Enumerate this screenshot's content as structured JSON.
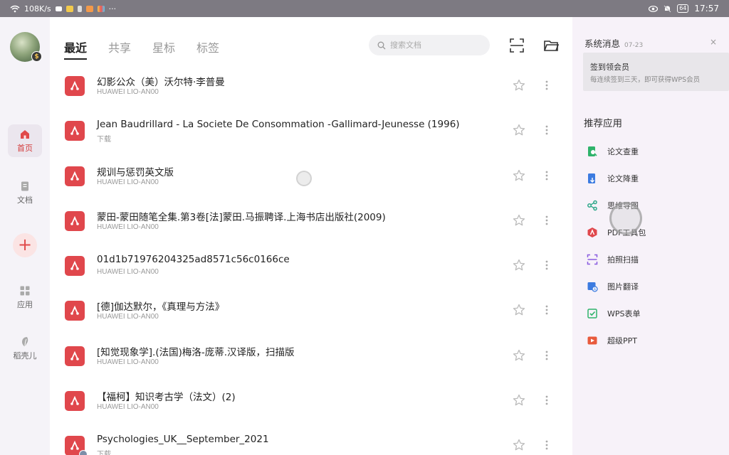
{
  "status_bar": {
    "network_speed": "108K/s",
    "overflow": "···",
    "battery": "64",
    "time": "17:57"
  },
  "left_nav": {
    "avatar_badge": "$",
    "items": [
      {
        "label": "首页",
        "icon": "home-icon",
        "active": true
      },
      {
        "label": "文档",
        "icon": "document-icon",
        "active": false
      },
      {
        "label": "应用",
        "icon": "apps-grid-icon",
        "active": false
      },
      {
        "label": "稻壳儿",
        "icon": "leaf-icon",
        "active": false
      }
    ],
    "add_label": "+"
  },
  "main": {
    "tabs": [
      {
        "label": "最近",
        "active": true
      },
      {
        "label": "共享",
        "active": false
      },
      {
        "label": "星标",
        "active": false
      },
      {
        "label": "标签",
        "active": false
      }
    ],
    "search_placeholder": "搜索文档",
    "files": [
      {
        "name": "幻影公众（美）沃尔特·李普曼",
        "source": "HUAWEI LIO-AN00"
      },
      {
        "name": "Jean Baudrillard - La Societe De Consommation -Gallimard-Jeunesse (1996)",
        "source": "下载"
      },
      {
        "name": "规训与惩罚英文版",
        "source": "HUAWEI LIO-AN00"
      },
      {
        "name": "蒙田-蒙田随笔全集.第3卷[法]蒙田.马振聘译.上海书店出版社(2009)",
        "source": "HUAWEI LIO-AN00"
      },
      {
        "name": "01d1b71976204325ad8571c56c0166ce",
        "source": "HUAWEI LIO-AN00"
      },
      {
        "name": "[德]伽达默尔，《真理与方法》",
        "source": "HUAWEI LIO-AN00"
      },
      {
        "name": "[知觉现象学].(法国)梅洛-庞蒂.汉译版，扫描版",
        "source": "HUAWEI LIO-AN00"
      },
      {
        "name": "【福柯】知识考古学（法文）(2)",
        "source": "HUAWEI LIO-AN00"
      },
      {
        "name": "Psychologies_UK__September_2021",
        "source": "下载"
      }
    ]
  },
  "right_panel": {
    "message_title": "系统消息",
    "message_date": "07-23",
    "message_close": "×",
    "message_card_title": "签到领会员",
    "message_card_body": "每连续签到三天，即可获得WPS会员",
    "apps_title": "推荐应用",
    "apps": [
      {
        "label": "论文查重",
        "icon": "paper-check-icon",
        "color": "#2fb36b"
      },
      {
        "label": "论文降重",
        "icon": "paper-rewrite-icon",
        "color": "#3c7be0"
      },
      {
        "label": "思维导图",
        "icon": "mindmap-icon",
        "color": "#2fa88a"
      },
      {
        "label": "PDF工具包",
        "icon": "pdf-toolkit-icon",
        "color": "#e0474c"
      },
      {
        "label": "拍照扫描",
        "icon": "photo-scan-icon",
        "color": "#8a5de0"
      },
      {
        "label": "图片翻译",
        "icon": "image-translate-icon",
        "color": "#3c7be0"
      },
      {
        "label": "WPS表单",
        "icon": "wps-form-icon",
        "color": "#2fb36b"
      },
      {
        "label": "超级PPT",
        "icon": "super-ppt-icon",
        "color": "#e85a3c"
      }
    ]
  },
  "colors": {
    "accent": "#d33a3a",
    "pdf_icon": "#e0474c",
    "status_bar": "#7d7a82"
  }
}
